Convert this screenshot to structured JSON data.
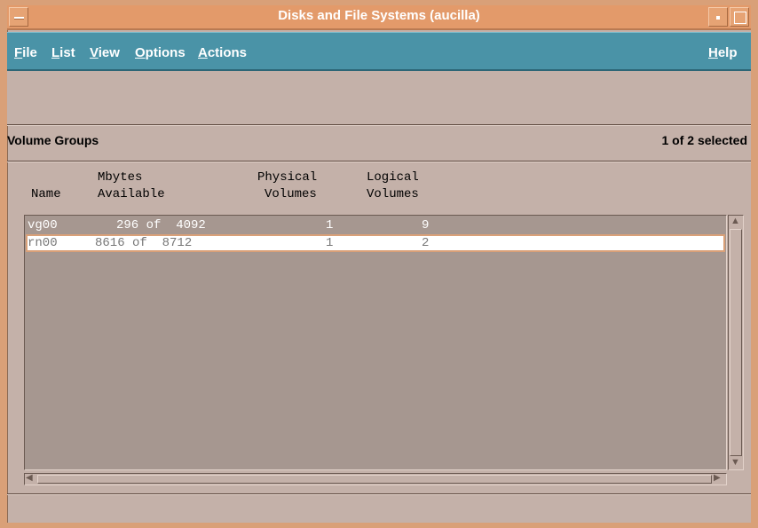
{
  "window": {
    "title": "Disks and File Systems (aucilla)",
    "frame_color": "#d9a078",
    "menubar_color": "#4a93a7"
  },
  "menubar": {
    "items": [
      {
        "label": "File",
        "mnemonic": "F"
      },
      {
        "label": "List",
        "mnemonic": "L"
      },
      {
        "label": "View",
        "mnemonic": "V"
      },
      {
        "label": "Options",
        "mnemonic": "O"
      },
      {
        "label": "Actions",
        "mnemonic": "A"
      }
    ],
    "help": {
      "label": "Help",
      "mnemonic": "H"
    }
  },
  "section": {
    "title": "Volume Groups",
    "selection_count": "1 of 2 selected"
  },
  "columns": {
    "name": "Name",
    "mbytes_line1": "Mbytes",
    "mbytes_line2": "Available",
    "physical_line1": "Physical",
    "physical_line2": "Volumes",
    "logical_line1": "Logical",
    "logical_line2": "Volumes"
  },
  "rows": [
    {
      "name": "vg00",
      "mbytes": "296 of  4092",
      "physical": "1",
      "logical": "9",
      "selected": false
    },
    {
      "name": "rn00",
      "mbytes": "8616 of  8712",
      "physical": "1",
      "logical": "2",
      "selected": true
    }
  ]
}
